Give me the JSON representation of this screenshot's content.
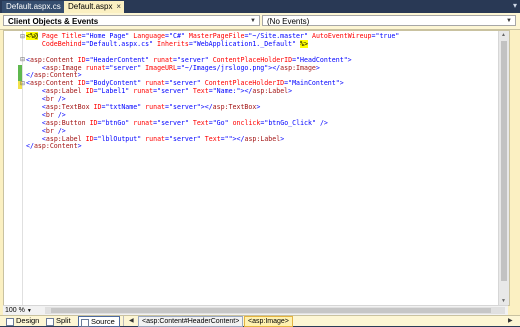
{
  "tabs": [
    {
      "label": "Default.aspx.cs"
    },
    {
      "label": "Default.aspx",
      "close": "×"
    }
  ],
  "tab_menu_icon": "▾",
  "dropdowns": {
    "left": "Client Objects & Events",
    "right": "(No Events)"
  },
  "code_lines": [
    [
      {
        "c": "dir",
        "t": "<%@"
      },
      {
        "c": "txt",
        "t": " "
      },
      {
        "c": "red",
        "t": "Page"
      },
      {
        "c": "txt",
        "t": " "
      },
      {
        "c": "red",
        "t": "Title"
      },
      {
        "c": "blue",
        "t": "=\"Home Page\""
      },
      {
        "c": "txt",
        "t": " "
      },
      {
        "c": "red",
        "t": "Language"
      },
      {
        "c": "blue",
        "t": "=\"C#\""
      },
      {
        "c": "txt",
        "t": " "
      },
      {
        "c": "red",
        "t": "MasterPageFile"
      },
      {
        "c": "blue",
        "t": "=\"~/Site.master\""
      },
      {
        "c": "txt",
        "t": " "
      },
      {
        "c": "red",
        "t": "AutoEventWireup"
      },
      {
        "c": "blue",
        "t": "=\"true\""
      }
    ],
    [
      {
        "c": "txt",
        "t": "    "
      },
      {
        "c": "red",
        "t": "CodeBehind"
      },
      {
        "c": "blue",
        "t": "=\"Default.aspx.cs\""
      },
      {
        "c": "txt",
        "t": " "
      },
      {
        "c": "red",
        "t": "Inherits"
      },
      {
        "c": "blue",
        "t": "=\"WebApplication1._Default\""
      },
      {
        "c": "txt",
        "t": " "
      },
      {
        "c": "dir",
        "t": "%>"
      }
    ],
    [],
    [
      {
        "c": "blue",
        "t": "<"
      },
      {
        "c": "maroon",
        "t": "asp:Content"
      },
      {
        "c": "txt",
        "t": " "
      },
      {
        "c": "red",
        "t": "ID"
      },
      {
        "c": "blue",
        "t": "=\"HeaderContent\""
      },
      {
        "c": "txt",
        "t": " "
      },
      {
        "c": "red",
        "t": "runat"
      },
      {
        "c": "blue",
        "t": "=\"server\""
      },
      {
        "c": "txt",
        "t": " "
      },
      {
        "c": "red",
        "t": "ContentPlaceHolderID"
      },
      {
        "c": "blue",
        "t": "=\"HeadContent\">"
      }
    ],
    [
      {
        "c": "txt",
        "t": "    "
      },
      {
        "c": "blue",
        "t": "<"
      },
      {
        "c": "maroon",
        "t": "asp:Image"
      },
      {
        "c": "txt",
        "t": " "
      },
      {
        "c": "red",
        "t": "runat"
      },
      {
        "c": "blue",
        "t": "=\"server\""
      },
      {
        "c": "txt",
        "t": " "
      },
      {
        "c": "red",
        "t": "ImageURL"
      },
      {
        "c": "blue",
        "t": "=\"~/Images/jrslogo.png\"></"
      },
      {
        "c": "maroon",
        "t": "asp:Image"
      },
      {
        "c": "blue",
        "t": ">"
      }
    ],
    [
      {
        "c": "blue",
        "t": "</"
      },
      {
        "c": "maroon",
        "t": "asp:Content"
      },
      {
        "c": "blue",
        "t": ">"
      }
    ],
    [
      {
        "c": "blue",
        "t": "<"
      },
      {
        "c": "maroon",
        "t": "asp:Content"
      },
      {
        "c": "txt",
        "t": " "
      },
      {
        "c": "red",
        "t": "ID"
      },
      {
        "c": "blue",
        "t": "=\"BodyContent\""
      },
      {
        "c": "txt",
        "t": " "
      },
      {
        "c": "red",
        "t": "runat"
      },
      {
        "c": "blue",
        "t": "=\"server\""
      },
      {
        "c": "txt",
        "t": " "
      },
      {
        "c": "red",
        "t": "ContentPlaceHolderID"
      },
      {
        "c": "blue",
        "t": "=\"MainContent\">"
      }
    ],
    [
      {
        "c": "txt",
        "t": "    "
      },
      {
        "c": "blue",
        "t": "<"
      },
      {
        "c": "maroon",
        "t": "asp:Label"
      },
      {
        "c": "txt",
        "t": " "
      },
      {
        "c": "red",
        "t": "ID"
      },
      {
        "c": "blue",
        "t": "=\"Label1\""
      },
      {
        "c": "txt",
        "t": " "
      },
      {
        "c": "red",
        "t": "runat"
      },
      {
        "c": "blue",
        "t": "=\"server\""
      },
      {
        "c": "txt",
        "t": " "
      },
      {
        "c": "red",
        "t": "Text"
      },
      {
        "c": "blue",
        "t": "=\"Name:\"></"
      },
      {
        "c": "maroon",
        "t": "asp:Label"
      },
      {
        "c": "blue",
        "t": ">"
      }
    ],
    [
      {
        "c": "txt",
        "t": "    "
      },
      {
        "c": "blue",
        "t": "<"
      },
      {
        "c": "maroon",
        "t": "br"
      },
      {
        "c": "txt",
        "t": " "
      },
      {
        "c": "blue",
        "t": "/>"
      }
    ],
    [
      {
        "c": "txt",
        "t": "    "
      },
      {
        "c": "blue",
        "t": "<"
      },
      {
        "c": "maroon",
        "t": "asp:TextBox"
      },
      {
        "c": "txt",
        "t": " "
      },
      {
        "c": "red",
        "t": "ID"
      },
      {
        "c": "blue",
        "t": "=\"txtName\""
      },
      {
        "c": "txt",
        "t": " "
      },
      {
        "c": "red",
        "t": "runat"
      },
      {
        "c": "blue",
        "t": "=\"server\"></"
      },
      {
        "c": "maroon",
        "t": "asp:TextBox"
      },
      {
        "c": "blue",
        "t": ">"
      }
    ],
    [
      {
        "c": "txt",
        "t": "    "
      },
      {
        "c": "blue",
        "t": "<"
      },
      {
        "c": "maroon",
        "t": "br"
      },
      {
        "c": "txt",
        "t": " "
      },
      {
        "c": "blue",
        "t": "/>"
      }
    ],
    [
      {
        "c": "txt",
        "t": "    "
      },
      {
        "c": "blue",
        "t": "<"
      },
      {
        "c": "maroon",
        "t": "asp:Button"
      },
      {
        "c": "txt",
        "t": " "
      },
      {
        "c": "red",
        "t": "ID"
      },
      {
        "c": "blue",
        "t": "=\"btnGo\""
      },
      {
        "c": "txt",
        "t": " "
      },
      {
        "c": "red",
        "t": "runat"
      },
      {
        "c": "blue",
        "t": "=\"server\""
      },
      {
        "c": "txt",
        "t": " "
      },
      {
        "c": "red",
        "t": "Text"
      },
      {
        "c": "blue",
        "t": "=\"Go\""
      },
      {
        "c": "txt",
        "t": " "
      },
      {
        "c": "red",
        "t": "onclick"
      },
      {
        "c": "blue",
        "t": "=\"btnGo_Click\""
      },
      {
        "c": "txt",
        "t": " "
      },
      {
        "c": "blue",
        "t": "/>"
      }
    ],
    [
      {
        "c": "txt",
        "t": "    "
      },
      {
        "c": "blue",
        "t": "<"
      },
      {
        "c": "maroon",
        "t": "br"
      },
      {
        "c": "txt",
        "t": " "
      },
      {
        "c": "blue",
        "t": "/>"
      }
    ],
    [
      {
        "c": "txt",
        "t": "    "
      },
      {
        "c": "blue",
        "t": "<"
      },
      {
        "c": "maroon",
        "t": "asp:Label"
      },
      {
        "c": "txt",
        "t": " "
      },
      {
        "c": "red",
        "t": "ID"
      },
      {
        "c": "blue",
        "t": "=\"lblOutput\""
      },
      {
        "c": "txt",
        "t": " "
      },
      {
        "c": "red",
        "t": "runat"
      },
      {
        "c": "blue",
        "t": "=\"server\""
      },
      {
        "c": "txt",
        "t": " "
      },
      {
        "c": "red",
        "t": "Text"
      },
      {
        "c": "blue",
        "t": "=\"\"></"
      },
      {
        "c": "maroon",
        "t": "asp:Label"
      },
      {
        "c": "blue",
        "t": ">"
      }
    ],
    [
      {
        "c": "blue",
        "t": "</"
      },
      {
        "c": "maroon",
        "t": "asp:Content"
      },
      {
        "c": "blue",
        "t": ">"
      }
    ]
  ],
  "outline_markers": [
    "⊟",
    "⊟",
    "⊟"
  ],
  "zoom": {
    "label": "100 %"
  },
  "view_buttons": [
    {
      "label": "Design"
    },
    {
      "label": "Split"
    },
    {
      "label": "Source"
    }
  ],
  "breadcrumbs": [
    {
      "label": "<asp:Content#HeaderContent>"
    },
    {
      "label": "<asp:Image>"
    }
  ],
  "colors": {
    "frame": "#293955",
    "tab_active": "#fbf0c2",
    "tag": "#a31515",
    "attribute": "#ff0000",
    "value": "#0000ff",
    "directive_bg": "#ffff00",
    "modified_gutter": "#5fb84e"
  }
}
